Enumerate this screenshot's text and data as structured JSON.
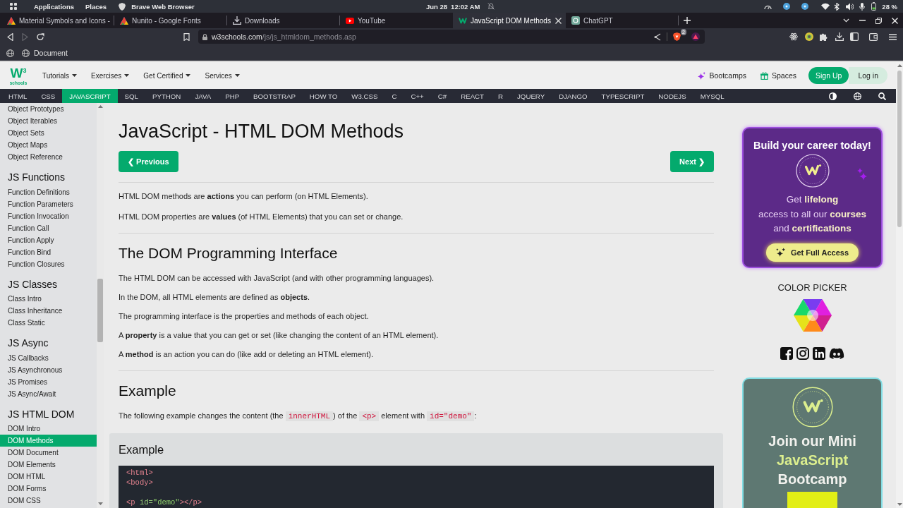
{
  "system_bar": {
    "menu": [
      "Applications",
      "Places"
    ],
    "active_app": "Brave Web Browser",
    "date": "Jun 28",
    "time": "12:02 AM",
    "battery": "28 %"
  },
  "browser": {
    "tabs": [
      {
        "title": "Material Symbols and Icons -",
        "kind": "google",
        "selected": false
      },
      {
        "title": "Nunito - Google Fonts",
        "kind": "google",
        "selected": false
      },
      {
        "title": "Downloads",
        "kind": "downloads",
        "selected": false
      },
      {
        "title": "YouTube",
        "kind": "youtube",
        "selected": false
      },
      {
        "title": "JavaScript DOM Methods",
        "kind": "w3",
        "selected": true
      },
      {
        "title": "ChatGPT",
        "kind": "chatgpt",
        "selected": false
      }
    ],
    "forward_disabled": true,
    "address": {
      "host": "w3schools.com",
      "path": "/js/js_htmldom_methods.asp"
    },
    "shield_count": "2",
    "bookmarks": [
      "Document"
    ]
  },
  "site_header": {
    "logo": {
      "mark": "W$^{3}$",
      "word": "schools"
    },
    "menu": [
      "Tutorials",
      "Exercises",
      "Get Certified",
      "Services"
    ],
    "links": [
      {
        "label": "Bootcamps",
        "kind": "bootcamps"
      },
      {
        "label": "Spaces",
        "kind": "spaces"
      }
    ],
    "sign_up": "Sign Up",
    "log_in": "Log in"
  },
  "topics": [
    {
      "label": "HTML",
      "selected": false
    },
    {
      "label": "CSS",
      "selected": false
    },
    {
      "label": "JAVASCRIPT",
      "selected": true
    },
    {
      "label": "SQL",
      "selected": false
    },
    {
      "label": "PYTHON",
      "selected": false
    },
    {
      "label": "JAVA",
      "selected": false
    },
    {
      "label": "PHP",
      "selected": false
    },
    {
      "label": "BOOTSTRAP",
      "selected": false
    },
    {
      "label": "HOW TO",
      "selected": false
    },
    {
      "label": "W3.CSS",
      "selected": false
    },
    {
      "label": "C",
      "selected": false
    },
    {
      "label": "C++",
      "selected": false
    },
    {
      "label": "C#",
      "selected": false
    },
    {
      "label": "REACT",
      "selected": false
    },
    {
      "label": "R",
      "selected": false
    },
    {
      "label": "JQUERY",
      "selected": false
    },
    {
      "label": "DJANGO",
      "selected": false
    },
    {
      "label": "TYPESCRIPT",
      "selected": false
    },
    {
      "label": "NODEJS",
      "selected": false
    },
    {
      "label": "MYSQL",
      "selected": false
    }
  ],
  "sidebar": {
    "groups": [
      {
        "items": [
          {
            "label": "Object Prototypes",
            "selected": false
          },
          {
            "label": "Object Iterables",
            "selected": false
          },
          {
            "label": "Object Sets",
            "selected": false
          },
          {
            "label": "Object Maps",
            "selected": false
          },
          {
            "label": "Object Reference",
            "selected": false
          }
        ]
      },
      {
        "heading": "JS Functions",
        "items": [
          {
            "label": "Function Definitions",
            "selected": false
          },
          {
            "label": "Function Parameters",
            "selected": false
          },
          {
            "label": "Function Invocation",
            "selected": false
          },
          {
            "label": "Function Call",
            "selected": false
          },
          {
            "label": "Function Apply",
            "selected": false
          },
          {
            "label": "Function Bind",
            "selected": false
          },
          {
            "label": "Function Closures",
            "selected": false
          }
        ]
      },
      {
        "heading": "JS Classes",
        "items": [
          {
            "label": "Class Intro",
            "selected": false
          },
          {
            "label": "Class Inheritance",
            "selected": false
          },
          {
            "label": "Class Static",
            "selected": false
          }
        ]
      },
      {
        "heading": "JS Async",
        "items": [
          {
            "label": "JS Callbacks",
            "selected": false
          },
          {
            "label": "JS Asynchronous",
            "selected": false
          },
          {
            "label": "JS Promises",
            "selected": false
          },
          {
            "label": "JS Async/Await",
            "selected": false
          }
        ]
      },
      {
        "heading": "JS HTML DOM",
        "items": [
          {
            "label": "DOM Intro",
            "selected": false
          },
          {
            "label": "DOM Methods",
            "selected": true
          },
          {
            "label": "DOM Document",
            "selected": false
          },
          {
            "label": "DOM Elements",
            "selected": false
          },
          {
            "label": "DOM HTML",
            "selected": false
          },
          {
            "label": "DOM Forms",
            "selected": false
          },
          {
            "label": "DOM CSS",
            "selected": false
          }
        ]
      }
    ]
  },
  "article": {
    "title": "JavaScript - HTML DOM Methods",
    "previous": "❮ Previous",
    "next": "Next ❯",
    "sections": [
      {
        "paragraphs": [
          "HTML DOM methods are **actions** you can perform (on HTML Elements).",
          "HTML DOM properties are **values** (of HTML Elements) that you can set or change."
        ]
      },
      {
        "heading": "The DOM Programming Interface",
        "paragraphs": [
          "The HTML DOM can be accessed with JavaScript (and with other programming languages).",
          "In the DOM, all HTML elements are defined as **objects**.",
          "The programming interface is the properties and methods of each object.",
          "A **property** is a value that you can get or set (like changing the content of an HTML element).",
          "A **method** is an action you can do (like add or deleting an HTML element)."
        ]
      },
      {
        "heading": "Example",
        "paragraphs": [
          {
            "parts": [
              {
                "kind": "text",
                "text": "The following example changes the content (the "
              },
              {
                "kind": "code",
                "text": "innerHTML"
              },
              {
                "kind": "text",
                "text": ") of the "
              },
              {
                "kind": "code",
                "text": "<p>"
              },
              {
                "kind": "text",
                "text": " element with "
              },
              {
                "kind": "code",
                "text": "id=\"demo\""
              },
              {
                "kind": "text",
                "text": ":"
              }
            ]
          }
        ],
        "example": {
          "heading": "Example",
          "code": "<html>\n<body>\n\n<p id=\"demo\"></p>"
        }
      }
    ]
  },
  "aside": {
    "career_promo": {
      "headline": "Build your career today!",
      "lines": [
        "Get **lifelong**",
        "access to all our **courses**",
        "and **certifications**"
      ],
      "button": "Get Full Access"
    },
    "color_picker": "COLOR PICKER",
    "bootcamp_promo": {
      "lines": [
        {
          "text": "Join our Mini",
          "highlight": false
        },
        {
          "text": "JavaScript",
          "highlight": true
        },
        {
          "text": "Bootcamp",
          "highlight": false
        }
      ]
    }
  }
}
